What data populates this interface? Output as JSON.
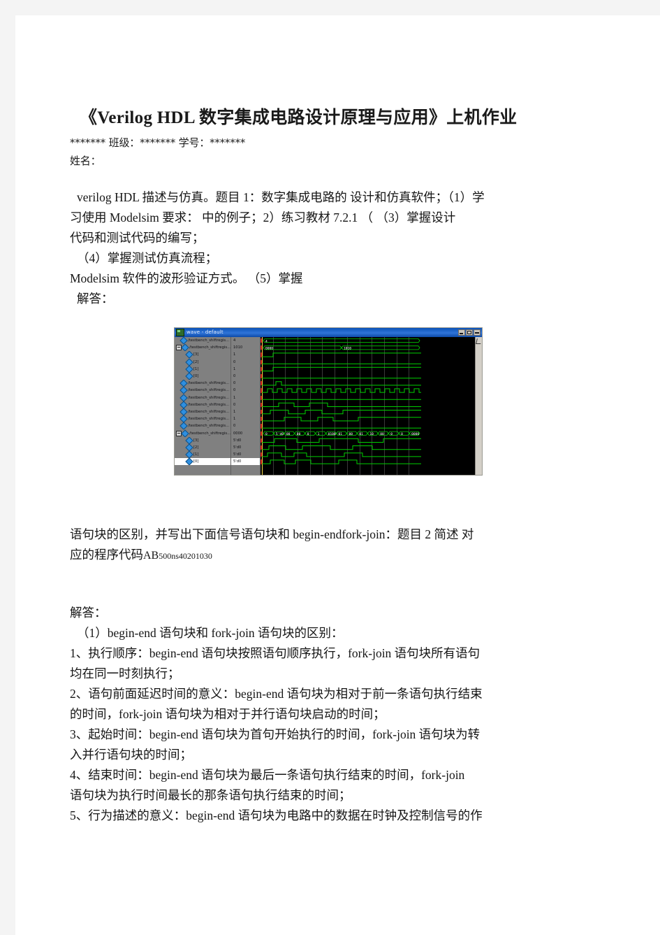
{
  "document": {
    "title": "《Verilog HDL 数字集成电路设计原理与应用》上机作业",
    "ident_line": "******* 班级：******* 学号：*******",
    "name_line": "姓名：",
    "intro": [
      "verilog HDL 描述与仿真。题目 1：数字集成电路的 设计和仿真软件；（1）学",
      "习使用 Modelsim 要求： 中的例子；2）练习教材 7.2.1 （ （3）掌握设计",
      "代码和测试代码的编写；",
      "（4）掌握测试仿真流程；",
      "Modelsim 软件的波形验证方式。 （5）掌握",
      "解答："
    ],
    "mid_paragraph_line1": "语句块的区别，并写出下面信号语句块和 begin-endfork-join：题目 2 简述 对",
    "mid_paragraph_line2_main": "应的程序代码",
    "mid_paragraph_line2_run_big": "AB",
    "mid_paragraph_line2_run_small": "500ns40201030",
    "answer_label": "解答：",
    "answer_items": [
      "（1）begin-end 语句块和 fork-join 语句块的区别：",
      "1、执行顺序：begin-end 语句块按照语句顺序执行，fork-join 语句块所有语句",
      "均在同一时刻执行；",
      "2、语句前面延迟时间的意义：begin-end 语句块为相对于前一条语句执行结束",
      "的时间，fork-join 语句块为相对于并行语句块启动的时间；",
      "3、起始时间：begin-end 语句块为首句开始执行的时间，fork-join 语句块为转",
      "入并行语句块的时间；",
      "4、结束时间：begin-end 语句块为最后一条语句执行结束的时间，fork-join",
      "语句块为执行时间最长的那条语句执行结束的时间；",
      "5、行为描述的意义：begin-end 语句块为电路中的数据在时钟及控制信号的作"
    ]
  },
  "waveform_figure": {
    "window_title": "wave - default",
    "titlebar_buttons": [
      "minimize",
      "maximize",
      "close"
    ],
    "colors": {
      "titlebar": "#0d4aa8",
      "panel": "#808080",
      "canvas": "#000000",
      "trace": "#00d000",
      "cursor": "#ffe14d",
      "marker": "#c01010"
    },
    "signals": [
      {
        "name": "/testbench_shiftregis...",
        "value": "4",
        "indent": 0,
        "expander": false,
        "selected": false
      },
      {
        "name": "/testbench_shiftregis...",
        "value": "1010",
        "indent": 0,
        "expander": true,
        "selected": false
      },
      {
        "name": "[3]",
        "value": "1",
        "indent": 1,
        "expander": false,
        "selected": false
      },
      {
        "name": "[2]",
        "value": "0",
        "indent": 1,
        "expander": false,
        "selected": false
      },
      {
        "name": "[1]",
        "value": "1",
        "indent": 1,
        "expander": false,
        "selected": false
      },
      {
        "name": "[0]",
        "value": "0",
        "indent": 1,
        "expander": false,
        "selected": false
      },
      {
        "name": "/testbench_shiftregis...",
        "value": "0",
        "indent": 0,
        "expander": false,
        "selected": false
      },
      {
        "name": "/testbench_shiftregis...",
        "value": "0",
        "indent": 0,
        "expander": false,
        "selected": false
      },
      {
        "name": "/testbench_shiftregis...",
        "value": "1",
        "indent": 0,
        "expander": false,
        "selected": false
      },
      {
        "name": "/testbench_shiftregis...",
        "value": "0",
        "indent": 0,
        "expander": false,
        "selected": false
      },
      {
        "name": "/testbench_shiftregis...",
        "value": "1",
        "indent": 0,
        "expander": false,
        "selected": false
      },
      {
        "name": "/testbench_shiftregis...",
        "value": "1",
        "indent": 0,
        "expander": false,
        "selected": false
      },
      {
        "name": "/testbench_shiftregis...",
        "value": "0",
        "indent": 0,
        "expander": false,
        "selected": false
      },
      {
        "name": "/testbench_shiftregis...",
        "value": "0000",
        "indent": 0,
        "expander": true,
        "selected": false
      },
      {
        "name": "[3]",
        "value": "5'd0",
        "indent": 1,
        "expander": false,
        "selected": false
      },
      {
        "name": "[2]",
        "value": "5'd0",
        "indent": 1,
        "expander": false,
        "selected": false
      },
      {
        "name": "[1]",
        "value": "5'd0",
        "indent": 1,
        "expander": false,
        "selected": false
      },
      {
        "name": "[0]",
        "value": "5'd0",
        "indent": 1,
        "expander": false,
        "selected": true
      }
    ],
    "bus_labels_top": [
      "0000",
      "1010"
    ],
    "bus_labels_bottom": [
      "0",
      "5'd0",
      "00",
      "00",
      "0",
      "1",
      "0100",
      "01",
      "00",
      "01",
      "10",
      "00",
      "0",
      "0",
      "0000"
    ]
  }
}
